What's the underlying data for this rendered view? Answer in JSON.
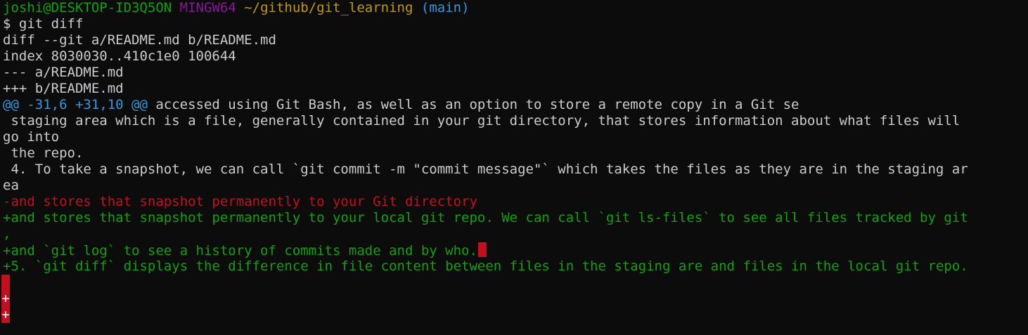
{
  "colors": {
    "background": "#0c0c0c",
    "default": "#cccccc",
    "prompt_user": "#13a10e",
    "prompt_msys": "#881798",
    "prompt_path": "#c19c00",
    "prompt_branch": "#3a96dd",
    "hunk": "#3a96dd",
    "removed": "#c50f1f",
    "added": "#13a10e",
    "cursor": "#c50f1f",
    "trailing_ws_bg": "#c50f1f"
  },
  "prompt": {
    "user_host": "joshi@DESKTOP-ID3Q5ON",
    "msystem": "MINGW64",
    "path": "~/github/git_learning",
    "branch": "(main)"
  },
  "command": {
    "symbol": "$",
    "text": "git diff"
  },
  "diff": {
    "header_git": "diff --git a/README.md b/README.md",
    "header_index": "index 8030030..410c1e0 100644",
    "header_old": "--- a/README.md",
    "header_new": "+++ b/README.md",
    "hunk_marker": "@@ -31,6 +31,10 @@",
    "hunk_context": " accessed using Git Bash, as well as an option to store a remote copy in a Git se",
    "context_1a": " staging area which is a file, generally contained in your git directory, that stores information about what files will",
    "context_1b": "go into",
    "context_2": " the repo.",
    "context_3a": " 4. To take a snapshot, we can call `git commit -m \"commit message\"` which takes the files as they are in the staging ar",
    "context_3b": "ea",
    "removed_1": "-and stores that snapshot permanently to your Git directory",
    "added_1a": "+and stores that snapshot permanently to your local git repo. We can call `git ls-files` to see all files tracked by git",
    "added_1b": ",",
    "added_2": "+and `git log` to see a history of commits made and by who.",
    "added_3": "+5. `git diff` displays the difference in file content between files in the staging are and files in the local git repo.",
    "added_4": "+",
    "added_5": "+"
  }
}
